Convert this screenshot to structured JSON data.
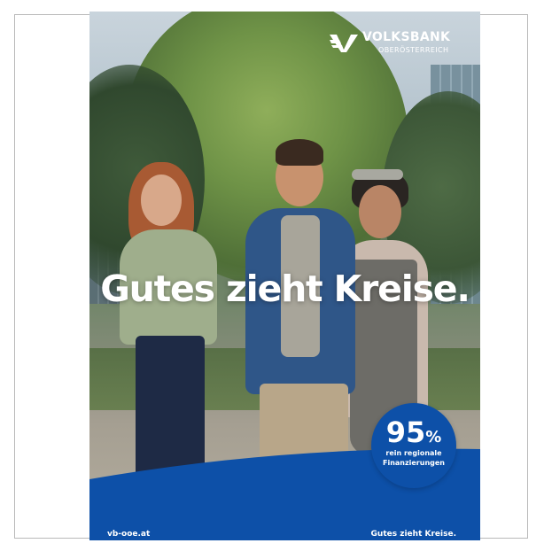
{
  "headline": "Gutes zieht Kreise.",
  "logo": {
    "name": "VOLKSBANK",
    "region": "OBERÖSTERREICH"
  },
  "badge": {
    "value": "95",
    "unit": "%",
    "line1": "rein regionale",
    "line2": "Finanzierungen"
  },
  "footer": {
    "url": "vb-ooe.at",
    "slogan": "Gutes zieht Kreise."
  },
  "colors": {
    "brand_blue": "#0d50a8",
    "text_white": "#ffffff"
  },
  "icons": [
    "volksbank-logo-icon"
  ]
}
